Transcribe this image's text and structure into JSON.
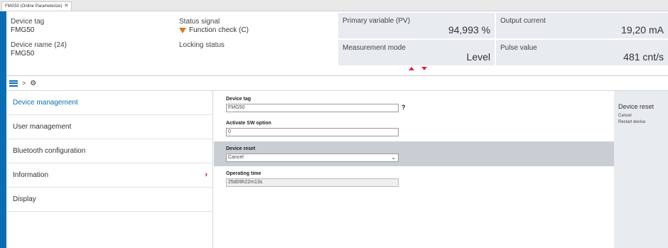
{
  "tab": {
    "label": "FMG50 (Online Parameterize)",
    "close": "✕"
  },
  "header": {
    "device_tag_label": "Device tag",
    "device_tag_value": "FMG50",
    "device_name_label": "Device name (24)",
    "device_name_value": "FMG50",
    "status_signal_label": "Status signal",
    "status_signal_value": "Function check (C)",
    "locking_status_label": "Locking status",
    "pv_label": "Primary variable (PV)",
    "pv_value": "94,993 %",
    "output_current_label": "Output current",
    "output_current_value": "19,20 mA",
    "measurement_mode_label": "Measurement mode",
    "measurement_mode_value": "Level",
    "pulse_value_label": "Pulse value",
    "pulse_value_value": "481 cnt/s"
  },
  "breadcrumb": {
    "separator": ">",
    "icon": "gear-icon"
  },
  "nav": {
    "items": [
      {
        "label": "Device management"
      },
      {
        "label": "User management"
      },
      {
        "label": "Bluetooth configuration"
      },
      {
        "label": "Information"
      },
      {
        "label": "Display"
      }
    ]
  },
  "form": {
    "device_tag_label": "Device tag",
    "device_tag_value": "FMG50",
    "help": "?",
    "activate_sw_label": "Activate SW option",
    "activate_sw_value": "0",
    "device_reset_label": "Device reset",
    "device_reset_value": "Cancel",
    "operating_time_label": "Operating time",
    "operating_time_value": "25d09h22m13s"
  },
  "info_panel": {
    "title": "Device reset",
    "lines": [
      "Cancel",
      "Restart device"
    ]
  },
  "colors": {
    "accent": "#0a6eb4",
    "warning": "#d97b1b",
    "highlight": "#c9ced4",
    "arrow": "#d6263a"
  }
}
